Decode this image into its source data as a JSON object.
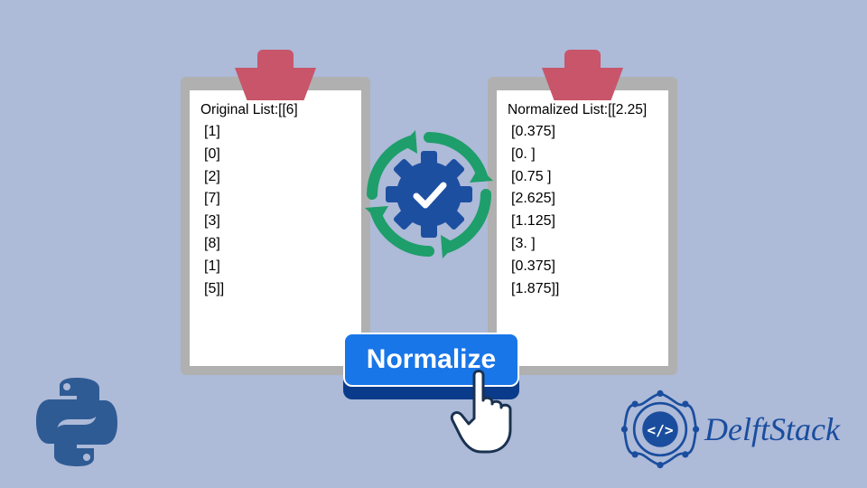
{
  "left_board": {
    "header": "Original List:[[6]",
    "lines": [
      "[1]",
      "[0]",
      "[2]",
      "[7]",
      "[3]",
      "[8]",
      "[1]",
      "[5]]"
    ]
  },
  "right_board": {
    "header": "Normalized List:[[2.25]",
    "lines": [
      "[0.375]",
      "[0.   ]",
      "[0.75 ]",
      "[2.625]",
      "[1.125]",
      "[3.   ]",
      "[0.375]",
      "[1.875]]"
    ]
  },
  "button": {
    "label": "Normalize"
  },
  "brand": {
    "name": "DelftStack"
  },
  "colors": {
    "bg": "#adbad8",
    "clip": "#c8556a",
    "board": "#b0b0b0",
    "green": "#1e9e6a",
    "gear": "#1d4fa1",
    "btn": "#1976e8",
    "btn_base": "#0a3b8a",
    "brand_blue": "#1a4d9e",
    "python_blue": "#2f5b94",
    "python_yellow": "#2f5b94"
  }
}
